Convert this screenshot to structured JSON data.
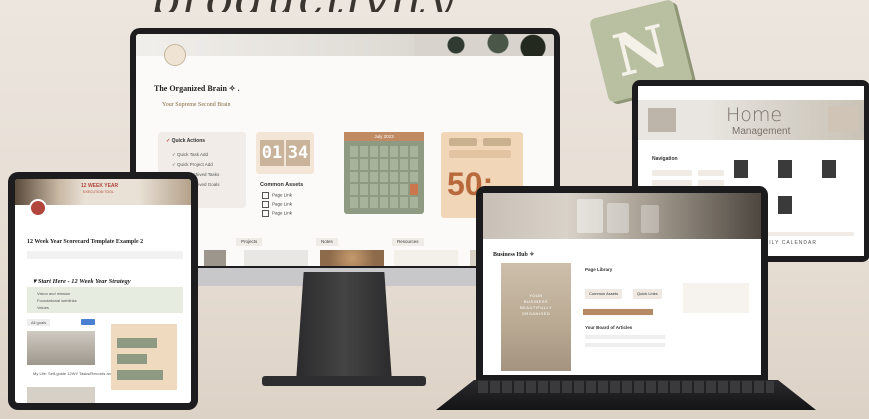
{
  "headline": "productivity",
  "monitor": {
    "title": "The Organized Brain ✧ .",
    "subtitle": "Your Supreme Second Brain",
    "quick_actions": {
      "heading": "Quick Actions",
      "items": [
        "Quick Task Add",
        "Quick Project Add",
        "Go to Archived Tasks",
        "Go to Archived Goals"
      ]
    },
    "clock": {
      "hours": "01",
      "minutes": "34"
    },
    "common_assets": {
      "heading": "Common Assets",
      "items": [
        "Page Link",
        "Page Link",
        "Page Link"
      ]
    },
    "calendar_label": "July 2023",
    "timer_value": "50:",
    "tabs": [
      "Projects",
      "Notes",
      "Resources"
    ]
  },
  "right_tablet": {
    "home": "Home",
    "management": "Management",
    "section_label": "Navigation",
    "footer": "FAMILY CALENDAR"
  },
  "left_tablet": {
    "banner_title": "12 WEEK YEAR",
    "banner_sub": "EXECUTION TOOL",
    "title": "12 Week Year Scorecard Template Example 2",
    "section": "Start Here - 12 Week Year Strategy",
    "notes": [
      "Vision and mission",
      "Foundational weblinks",
      "Values"
    ],
    "photo_caption": "My Life: Self-guide 12WY Tasks/Records and Workflow",
    "tag": "All goals"
  },
  "laptop": {
    "title": "Business Hub ✧",
    "poster_lines": [
      "YOUR",
      "BUSINESS",
      "BEAUTIFULLY",
      "ORGANISED"
    ],
    "quick_links_label": "Page Library",
    "buttons": [
      "Common Assets",
      "Quick Links"
    ],
    "section2": "Your Board of Articles"
  },
  "colors": {
    "background": "#e9e2da",
    "sage": "#8e9a82",
    "terracotta": "#c08a63",
    "notion_logo": "#b9bfa1"
  }
}
